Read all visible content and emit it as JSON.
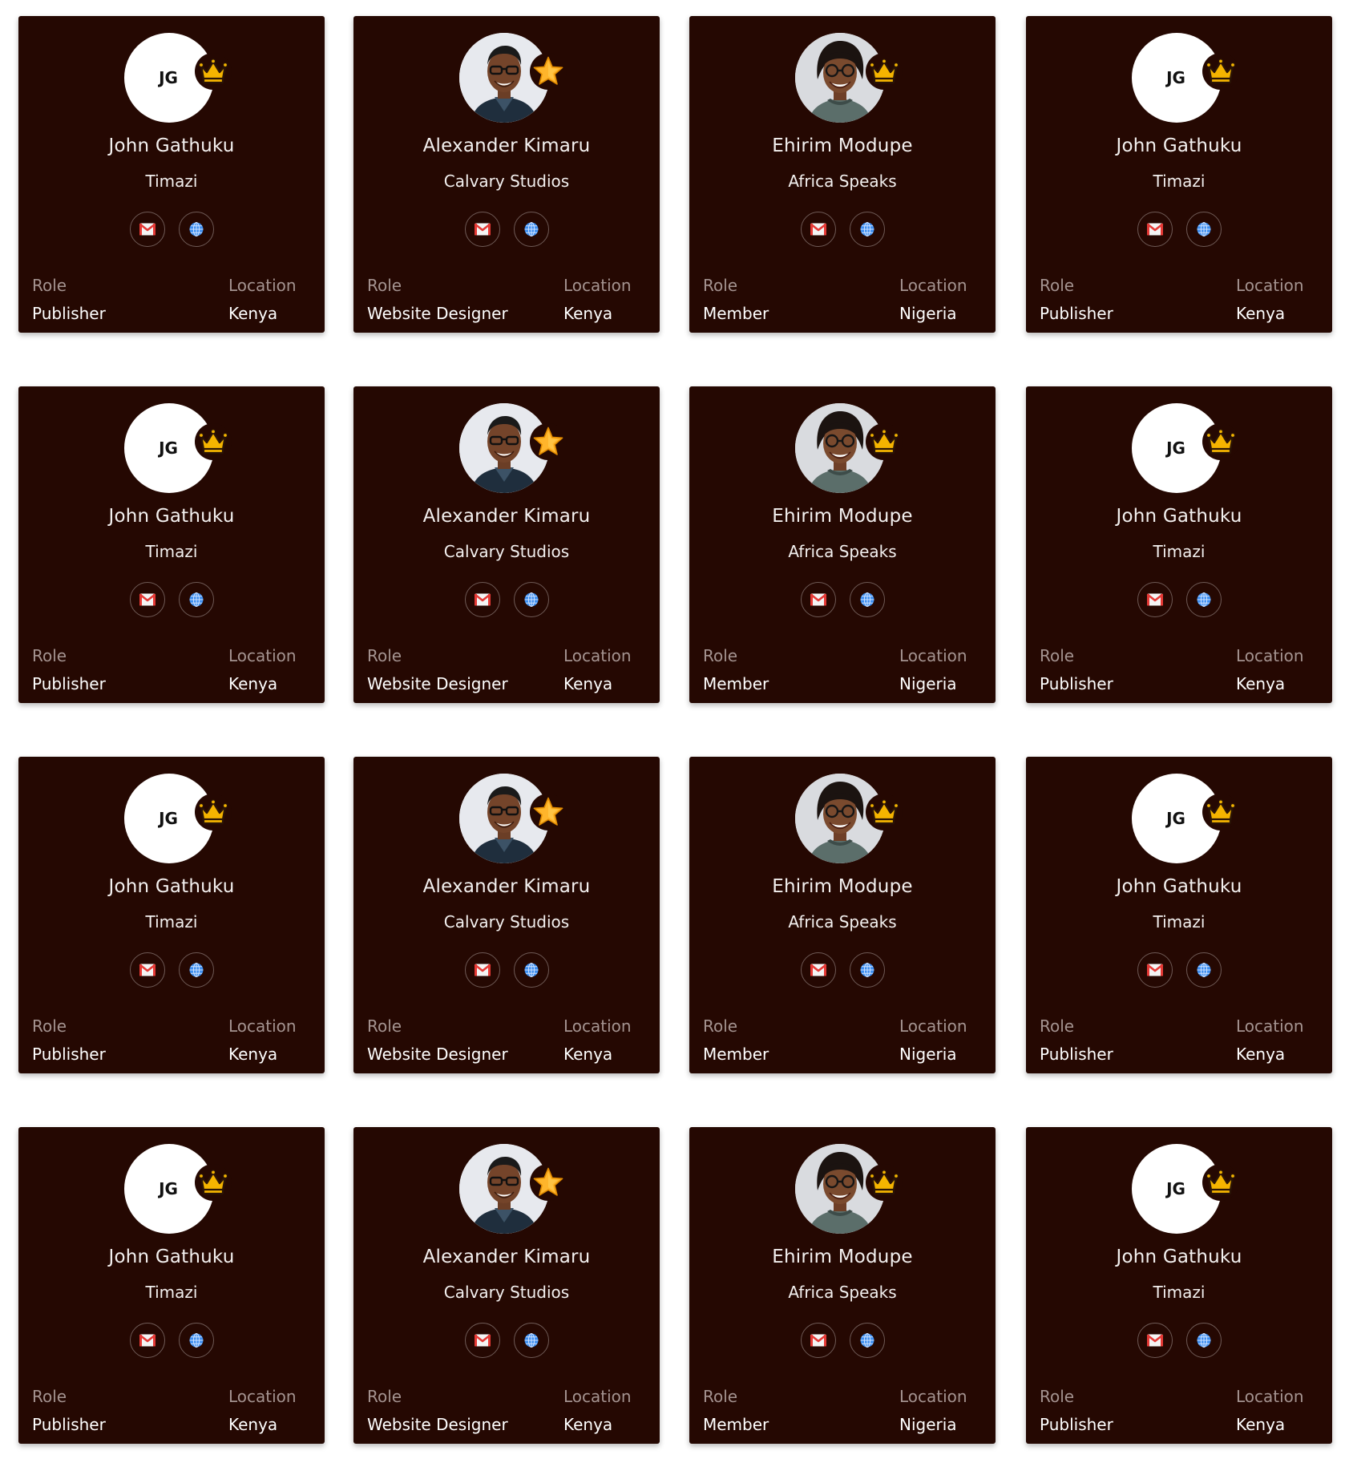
{
  "labels": {
    "role": "Role",
    "location": "Location"
  },
  "profiles": {
    "jg": {
      "name": "John Gathuku",
      "org": "Timazi",
      "role": "Publisher",
      "location": "Kenya",
      "initials": "JG",
      "avatar_icon": "initials-avatar",
      "badge_icon": "crown-icon"
    },
    "ak": {
      "name": "Alexander Kimaru",
      "org": "Calvary Studios",
      "role": "Website Designer",
      "location": "Kenya",
      "avatar_icon": "man-photo-avatar",
      "badge_icon": "star-icon"
    },
    "em": {
      "name": "Ehirim Modupe",
      "org": "Africa Speaks",
      "role": "Member",
      "location": "Nigeria",
      "avatar_icon": "woman-photo-avatar",
      "badge_icon": "crown-icon"
    }
  },
  "cards": [
    "jg",
    "ak",
    "em",
    "jg",
    "jg",
    "ak",
    "em",
    "jg",
    "jg",
    "ak",
    "em",
    "jg",
    "jg",
    "ak",
    "em",
    "jg"
  ],
  "actions": [
    {
      "name": "email-button",
      "icon": "mail-icon"
    },
    {
      "name": "website-button",
      "icon": "globe-icon"
    }
  ],
  "colors": {
    "page_background": "#ffffff",
    "card_background": "#250802",
    "text_primary": "#f3f0ef",
    "text_muted": "#a49390",
    "crown_gold": "#f5b400",
    "star_gold": "#ffb52b",
    "mail_red": "#e53935",
    "globe_blue": "#3d8ef0"
  }
}
